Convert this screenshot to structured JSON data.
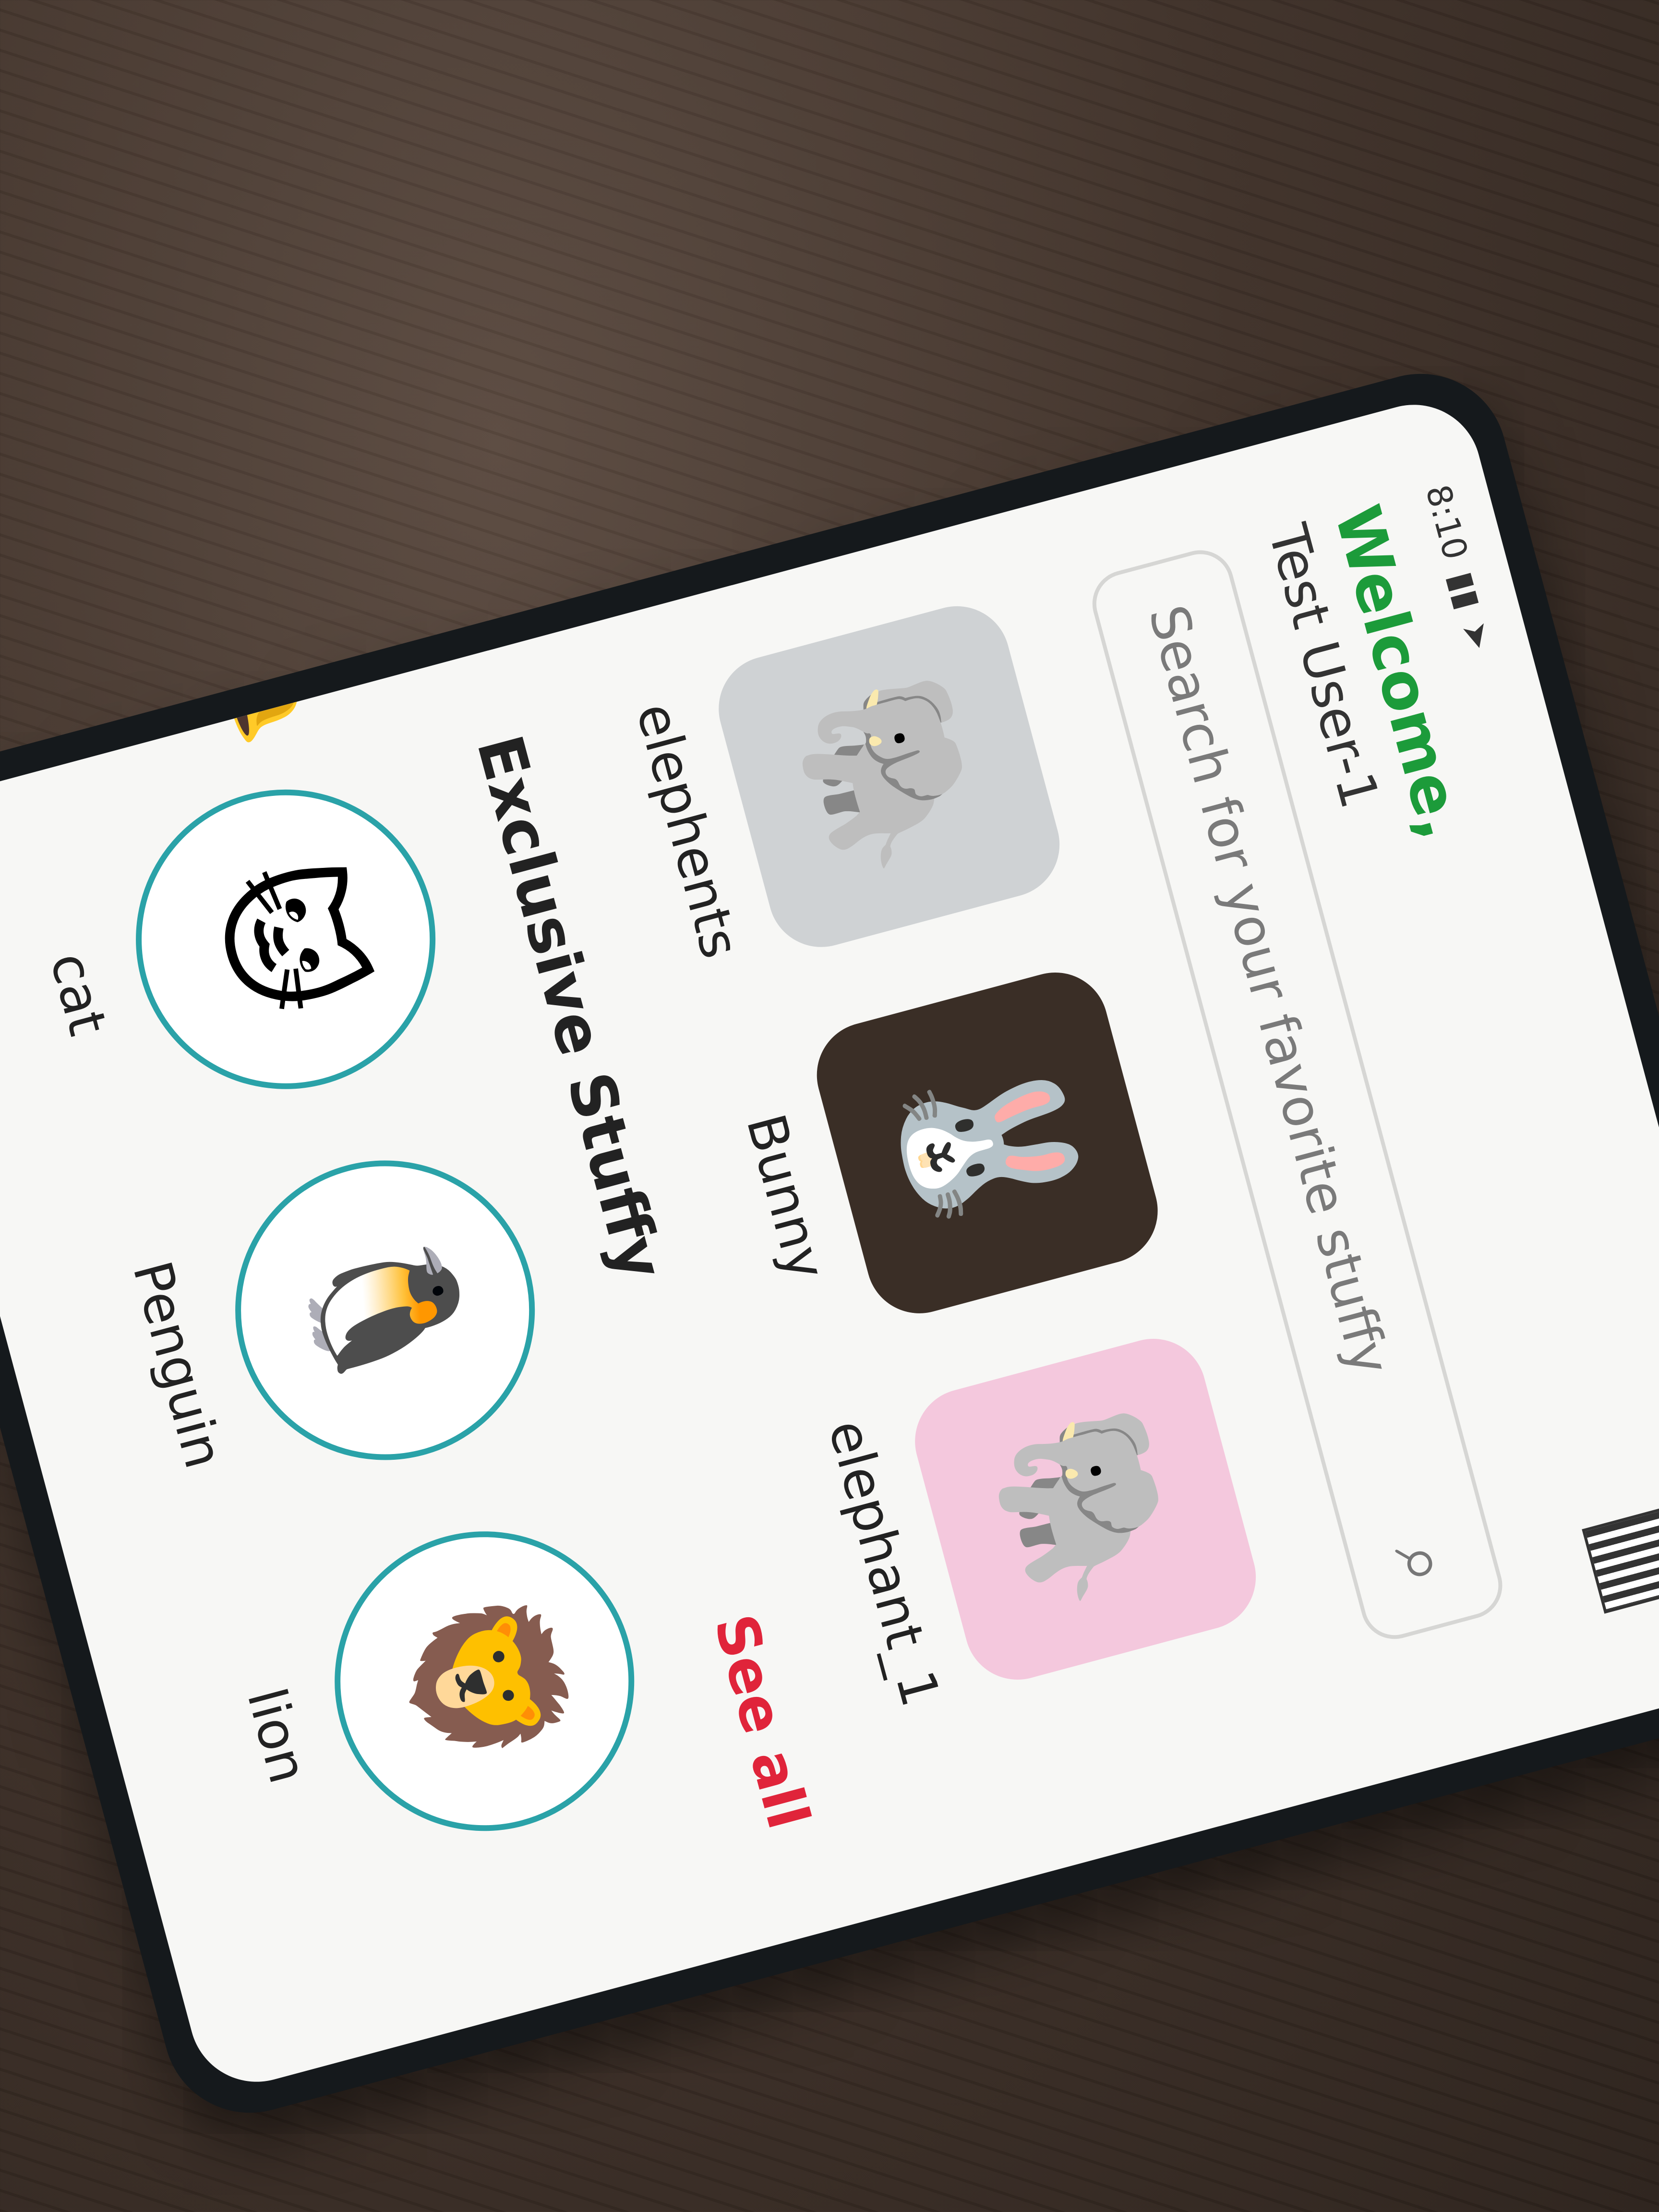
{
  "status": {
    "time": "8:10"
  },
  "header": {
    "welcome": "Welcome,",
    "user": "Test User-1"
  },
  "search": {
    "placeholder": "Search for your favorite stuffy"
  },
  "cards": [
    {
      "label": "elephents",
      "icon": "elephant-plush-icon",
      "bg": "#cfd2d4"
    },
    {
      "label": "Bunny",
      "icon": "bunny-plush-icon",
      "bg": "#3a2e26"
    },
    {
      "label": "elephant_1",
      "icon": "elephant-pink-plush-icon",
      "bg": "#f4c8dd"
    }
  ],
  "section": {
    "title": "Exclusive Stuffy",
    "see_all": "See all"
  },
  "circles": [
    {
      "label": "cat",
      "icon": "cat-plush-icon"
    },
    {
      "label": "Penguin",
      "icon": "penguin-plush-icon"
    },
    {
      "label": "lion",
      "icon": "lion-plush-icon"
    }
  ],
  "colors": {
    "accent_green": "#1c9b3a",
    "accent_red": "#e0243a",
    "ring_teal": "#2aa2a8"
  }
}
